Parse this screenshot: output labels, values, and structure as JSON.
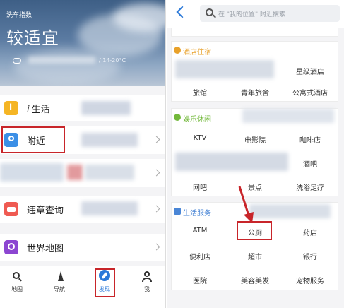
{
  "left": {
    "weather": {
      "caption": "洗车指数",
      "title": "较适宜",
      "info_fragment": "/ 14-20°C"
    },
    "menu": [
      {
        "id": "ilife",
        "label_prefix": "i",
        "label": "生活",
        "color": "#f5b524"
      },
      {
        "id": "nearby",
        "label": "附近",
        "color": "#3b8fe6"
      },
      {
        "id": "traffic",
        "label": "违章查询",
        "color": "#ef5a52"
      },
      {
        "id": "worldmap",
        "label": "世界地图",
        "color": "#8c46d1"
      }
    ],
    "tabs": [
      {
        "id": "map",
        "label": "地图"
      },
      {
        "id": "nav",
        "label": "导航"
      },
      {
        "id": "discover",
        "label": "发现",
        "active": true
      },
      {
        "id": "me",
        "label": "我"
      }
    ]
  },
  "right": {
    "search_placeholder": "在 \"我的位置\" 附近搜索",
    "sections": [
      {
        "id": "hotel",
        "title": "酒店住宿",
        "title_color": "#e8a12a",
        "rows": [
          [
            "",
            "",
            "星级酒店"
          ],
          [
            "旅馆",
            "青年旅舍",
            "公寓式酒店"
          ]
        ]
      },
      {
        "id": "fun",
        "title": "娱乐休闲",
        "title_color": "#72b83a",
        "rows": [
          [
            "KTV",
            "电影院",
            "咖啡店"
          ],
          [
            "",
            "",
            "酒吧"
          ],
          [
            "网吧",
            "景点",
            "洗浴足疗"
          ]
        ]
      },
      {
        "id": "life",
        "title": "生活服务",
        "title_color": "#4a86d6",
        "rows": [
          [
            "ATM",
            "公厕",
            "药店"
          ],
          [
            "便利店",
            "超市",
            "银行"
          ],
          [
            "医院",
            "美容美发",
            "宠物服务"
          ]
        ]
      }
    ]
  },
  "colors": {
    "highlight": "#c8252a",
    "accent_blue": "#2a78d8"
  }
}
